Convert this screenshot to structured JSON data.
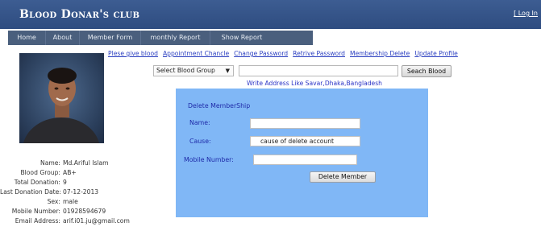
{
  "header": {
    "title": "Blood Donar's club",
    "login_link": "[ Log In"
  },
  "nav": [
    {
      "label": "Home"
    },
    {
      "label": "About"
    },
    {
      "label": "Member Form"
    },
    {
      "label": "monthly Report"
    },
    {
      "label": "Show Report"
    }
  ],
  "links": [
    "Plese give blood",
    "Appointment Chancle",
    "Change Password",
    "Retrive Password",
    "Membership Delete",
    "Update Profile"
  ],
  "search": {
    "select_value": "Select Blood Group",
    "input_value": "",
    "button_label": "Seach Blood",
    "hint": "Write Address Like Savar,Dhaka,Bangladesh"
  },
  "delete_panel": {
    "title": "Delete MemberShip",
    "name_label": "Name:",
    "name_value": "",
    "cause_label": "Cause:",
    "cause_value": "cause of delete account",
    "mobile_label": "Mobile Number:",
    "mobile_value": "",
    "button_label": "Delete Member"
  },
  "profile": [
    {
      "label": "Name:",
      "value": "Md.Ariful Islam"
    },
    {
      "label": "Blood Group:",
      "value": "AB+"
    },
    {
      "label": "Total Donation:",
      "value": "9"
    },
    {
      "label": "Last Donation Date:",
      "value": "07-12-2013"
    },
    {
      "label": "Sex:",
      "value": "male"
    },
    {
      "label": "Mobile Number:",
      "value": "01928594679"
    },
    {
      "label": "Email Address:",
      "value": "arif.i01.ju@gmail.com"
    }
  ],
  "colors": {
    "header_bg": "#3d5d92",
    "nav_bg": "#4a5f7d",
    "panel_bg": "#80b7f6",
    "link": "#2a3ec0"
  }
}
